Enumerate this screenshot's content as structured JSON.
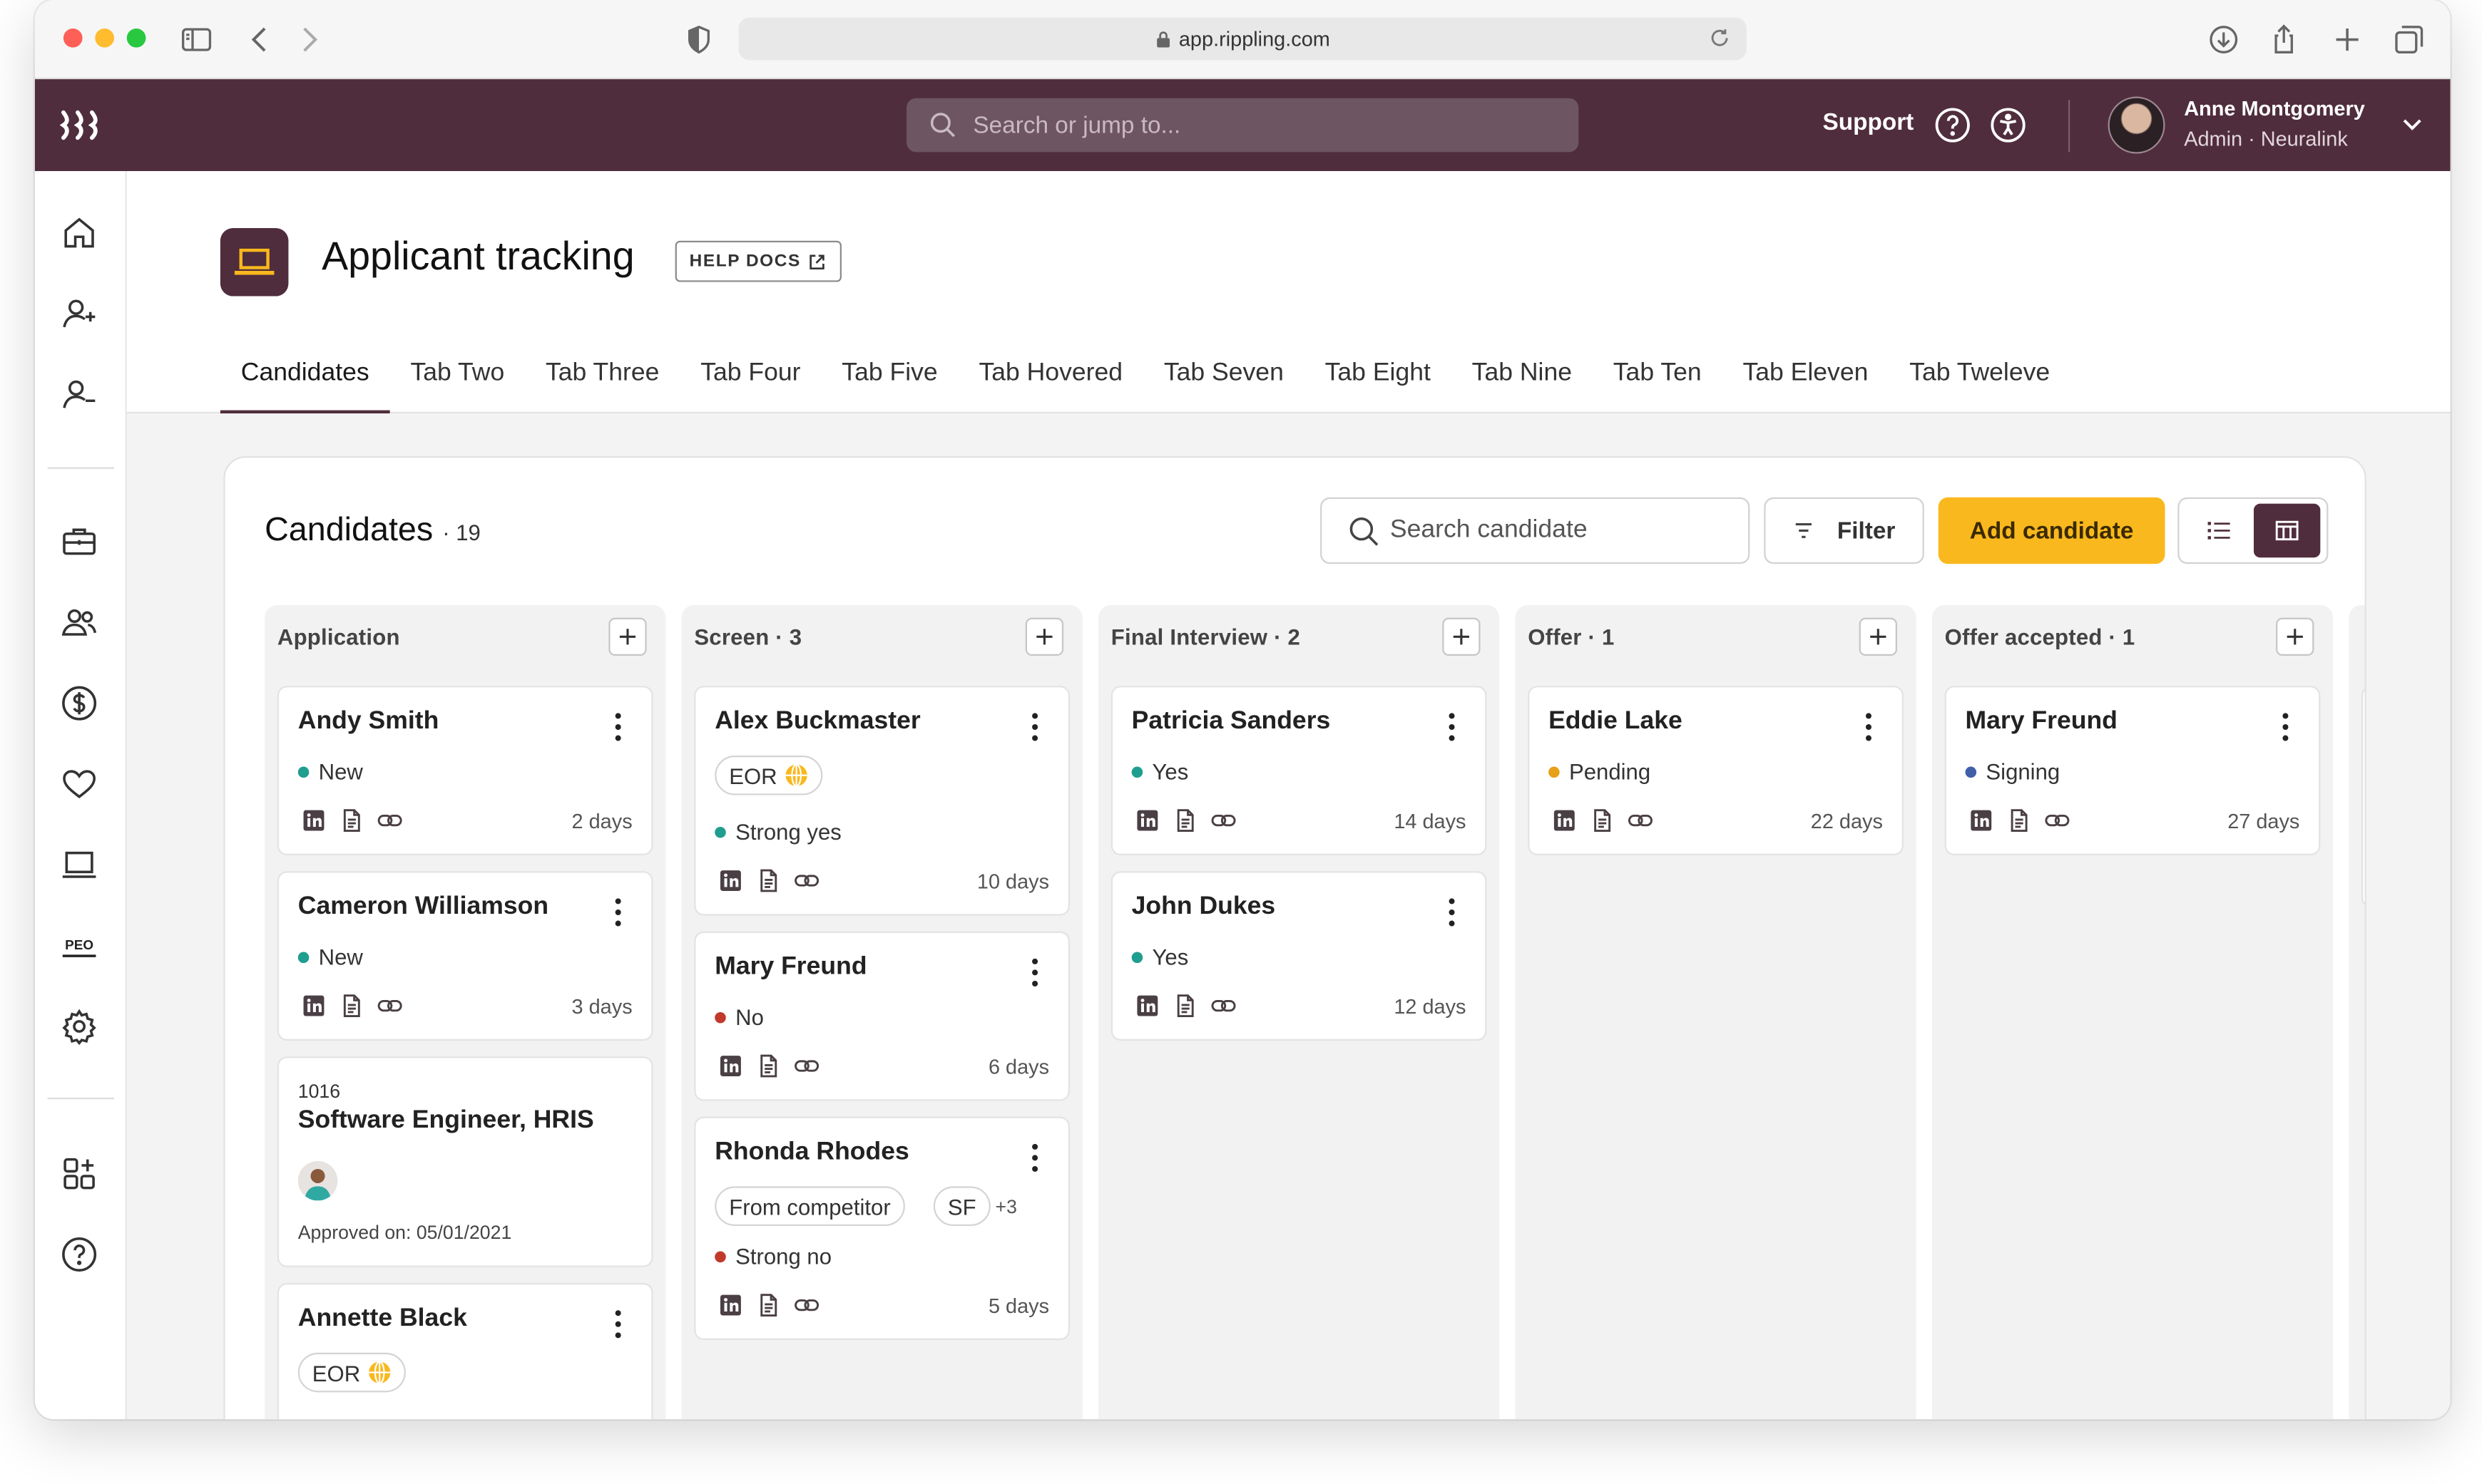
{
  "browser": {
    "url": "app.rippling.com"
  },
  "topbar": {
    "search_placeholder": "Search or jump to...",
    "support_label": "Support",
    "user_name": "Anne Montgomery",
    "user_role": "Admin · Neuralink"
  },
  "header": {
    "title": "Applicant tracking",
    "help_docs": "HELP DOCS",
    "tabs": [
      {
        "label": "Candidates",
        "active": true
      },
      {
        "label": "Tab Two"
      },
      {
        "label": "Tab Three"
      },
      {
        "label": "Tab Four"
      },
      {
        "label": "Tab Five"
      },
      {
        "label": "Tab Hovered"
      },
      {
        "label": "Tab Seven"
      },
      {
        "label": "Tab Eight"
      },
      {
        "label": "Tab Nine"
      },
      {
        "label": "Tab Ten"
      },
      {
        "label": "Tab Eleven"
      },
      {
        "label": "Tab Tweleve"
      }
    ]
  },
  "panel": {
    "title": "Candidates",
    "count": "· 19",
    "search_placeholder": "Search candidate",
    "filter_label": "Filter",
    "add_label": "Add candidate",
    "accent": "#f9b81d",
    "brand": "#502d3c"
  },
  "columns": [
    {
      "title": "Application",
      "cards": [
        {
          "name": "Andy Smith",
          "status": "New",
          "status_color": "#1f9e8f",
          "days": "2 days"
        },
        {
          "name": "Cameron Williamson",
          "status": "New",
          "status_color": "#1f9e8f",
          "days": "3 days"
        },
        {
          "req_id": "1016",
          "req_title": "Software Engineer, HRIS",
          "approved": "Approved on: 05/01/2021"
        },
        {
          "name": "Annette Black",
          "chip": "EOR"
        }
      ]
    },
    {
      "title": "Screen · 3",
      "cards": [
        {
          "name": "Alex Buckmaster",
          "chip": "EOR",
          "status": "Strong yes",
          "status_color": "#1f9e8f",
          "days": "10 days"
        },
        {
          "name": "Mary Freund",
          "status": "No",
          "status_color": "#c0392b",
          "days": "6 days"
        },
        {
          "name": "Rhonda Rhodes",
          "chips": [
            "From competitor",
            "SF"
          ],
          "more": "+3",
          "status": "Strong no",
          "status_color": "#c0392b",
          "days": "5 days"
        }
      ]
    },
    {
      "title": "Final Interview · 2",
      "cards": [
        {
          "name": "Patricia Sanders",
          "status": "Yes",
          "status_color": "#1f9e8f",
          "days": "14 days"
        },
        {
          "name": "John Dukes",
          "status": "Yes",
          "status_color": "#1f9e8f",
          "days": "12 days"
        }
      ]
    },
    {
      "title": "Offer · 1",
      "cards": [
        {
          "name": "Eddie Lake",
          "status": "Pending",
          "status_color": "#e6a117",
          "days": "22 days"
        }
      ]
    },
    {
      "title": "Offer accepted · 1",
      "cards": [
        {
          "name": "Mary Freund",
          "status": "Signing",
          "status_color": "#3f5fa8",
          "days": "27 days"
        }
      ]
    }
  ]
}
